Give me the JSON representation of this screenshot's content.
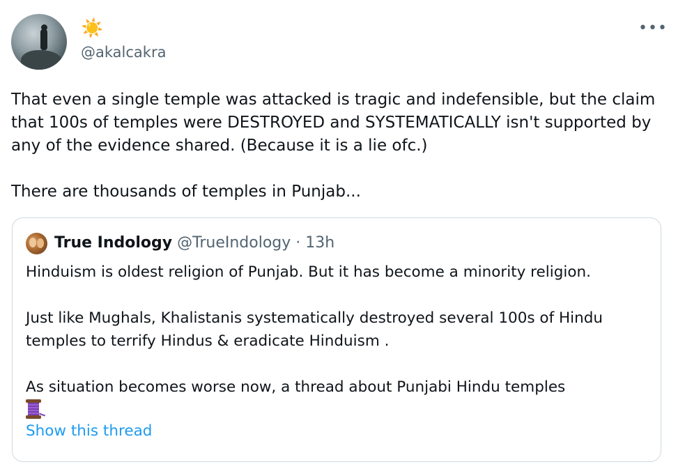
{
  "tweet": {
    "display_name": "☀️",
    "handle": "@akalcakra",
    "more_label": "•••",
    "text_paragraphs": [
      "That even a single temple was attacked is tragic and indefensible, but the claim that 100s of temples were DESTROYED and SYSTEMATICALLY isn't supported by any of the evidence shared. (Because it is a lie ofc.)",
      "There are thousands of temples in Punjab..."
    ]
  },
  "quote": {
    "name": "True Indology",
    "handle": "@TrueIndology",
    "separator": "·",
    "time": "13h",
    "paragraphs": [
      "Hinduism is oldest religion of Punjab. But it has become a minority religion.",
      "Just like Mughals, Khalistanis systematically destroyed several 100s of Hindu temples to terrify Hindus & eradicate Hinduism .",
      "As situation  becomes worse now, a thread about Punjabi Hindu temples"
    ],
    "emoji_icon": "spool-of-thread",
    "show_thread_label": "Show this thread"
  },
  "colors": {
    "link": "#1d9bf0",
    "secondary_text": "#536471",
    "border": "#cfd9de"
  }
}
